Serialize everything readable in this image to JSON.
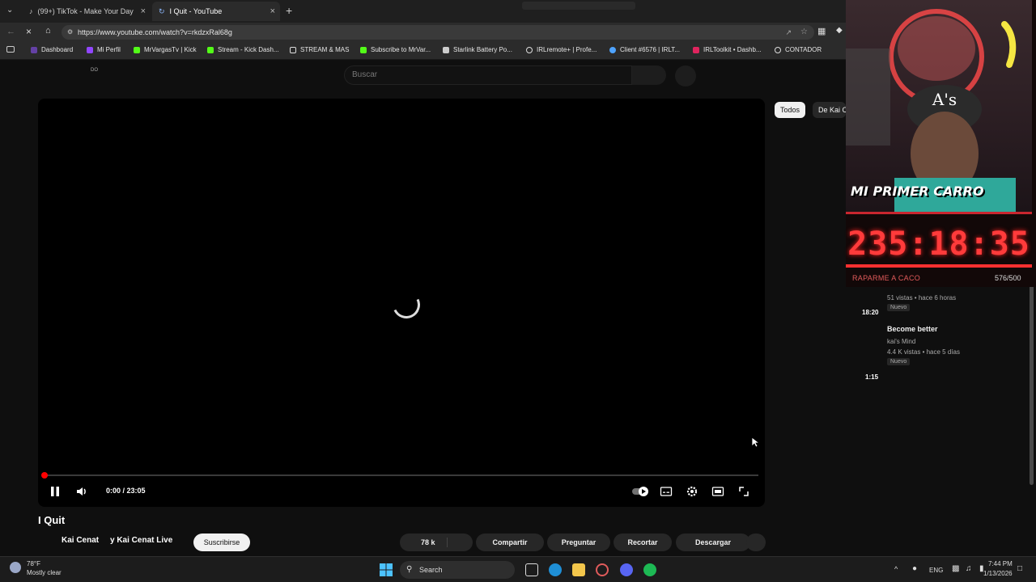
{
  "browser": {
    "tabs": [
      {
        "title": "(99+) TikTok - Make Your Day"
      },
      {
        "title": "I Quit - YouTube"
      }
    ],
    "url": "https://www.youtube.com/watch?v=rkdzxRal68g",
    "bookmarks": [
      "Dashboard",
      "Mi Perfil",
      "MrVargasTv | Kick",
      "Stream - Kick Dash...",
      "STREAM & MAS",
      "Subscribe to MrVar...",
      "Starlink Battery Po...",
      "IRLremote+ | Profe...",
      "Client #6576 | IRLT...",
      "IRLToolkit • Dashb...",
      "CONTADOR"
    ]
  },
  "youtube": {
    "logo_fragment": "DO",
    "search_placeholder": "Buscar",
    "player": {
      "time": "0:00 / 23:05",
      "progress": 0.0
    },
    "video_title": "I Quit",
    "channels": [
      "Kai Cenat",
      "y Kai Cenat Live"
    ],
    "subscribe_label": "Suscribirse",
    "actions": {
      "likes": "78 k",
      "share": "Compartir",
      "ask": "Preguntar",
      "clip": "Recortar",
      "download": "Descargar"
    },
    "chips": [
      "Todos",
      "De Kai C"
    ],
    "sidebar": [
      {
        "title": "",
        "channel": "",
        "meta": "51 vistas • hace 6 horas",
        "badge": "Nuevo",
        "duration": "18:20"
      },
      {
        "title": "Become better",
        "channel": "kai's Mind",
        "meta": "4.4 K vistas • hace 5 días",
        "badge": "Nuevo",
        "duration": "1:15"
      }
    ]
  },
  "overlay": {
    "banner": "MI PRIMER CARRO",
    "timer": "235:18:35",
    "goal_label": "RAPARME A CACO",
    "goal_count": "576/500",
    "goal_progress": 1.0
  },
  "taskbar": {
    "weather_temp": "78°F",
    "weather_desc": "Mostly clear",
    "search": "Search",
    "lang": "ENG",
    "time": "7:44 PM",
    "date": "1/13/2026"
  },
  "colors": {
    "accent": "#ff0000",
    "timer": "#ff3b3b",
    "goal": "#e35b5b"
  }
}
